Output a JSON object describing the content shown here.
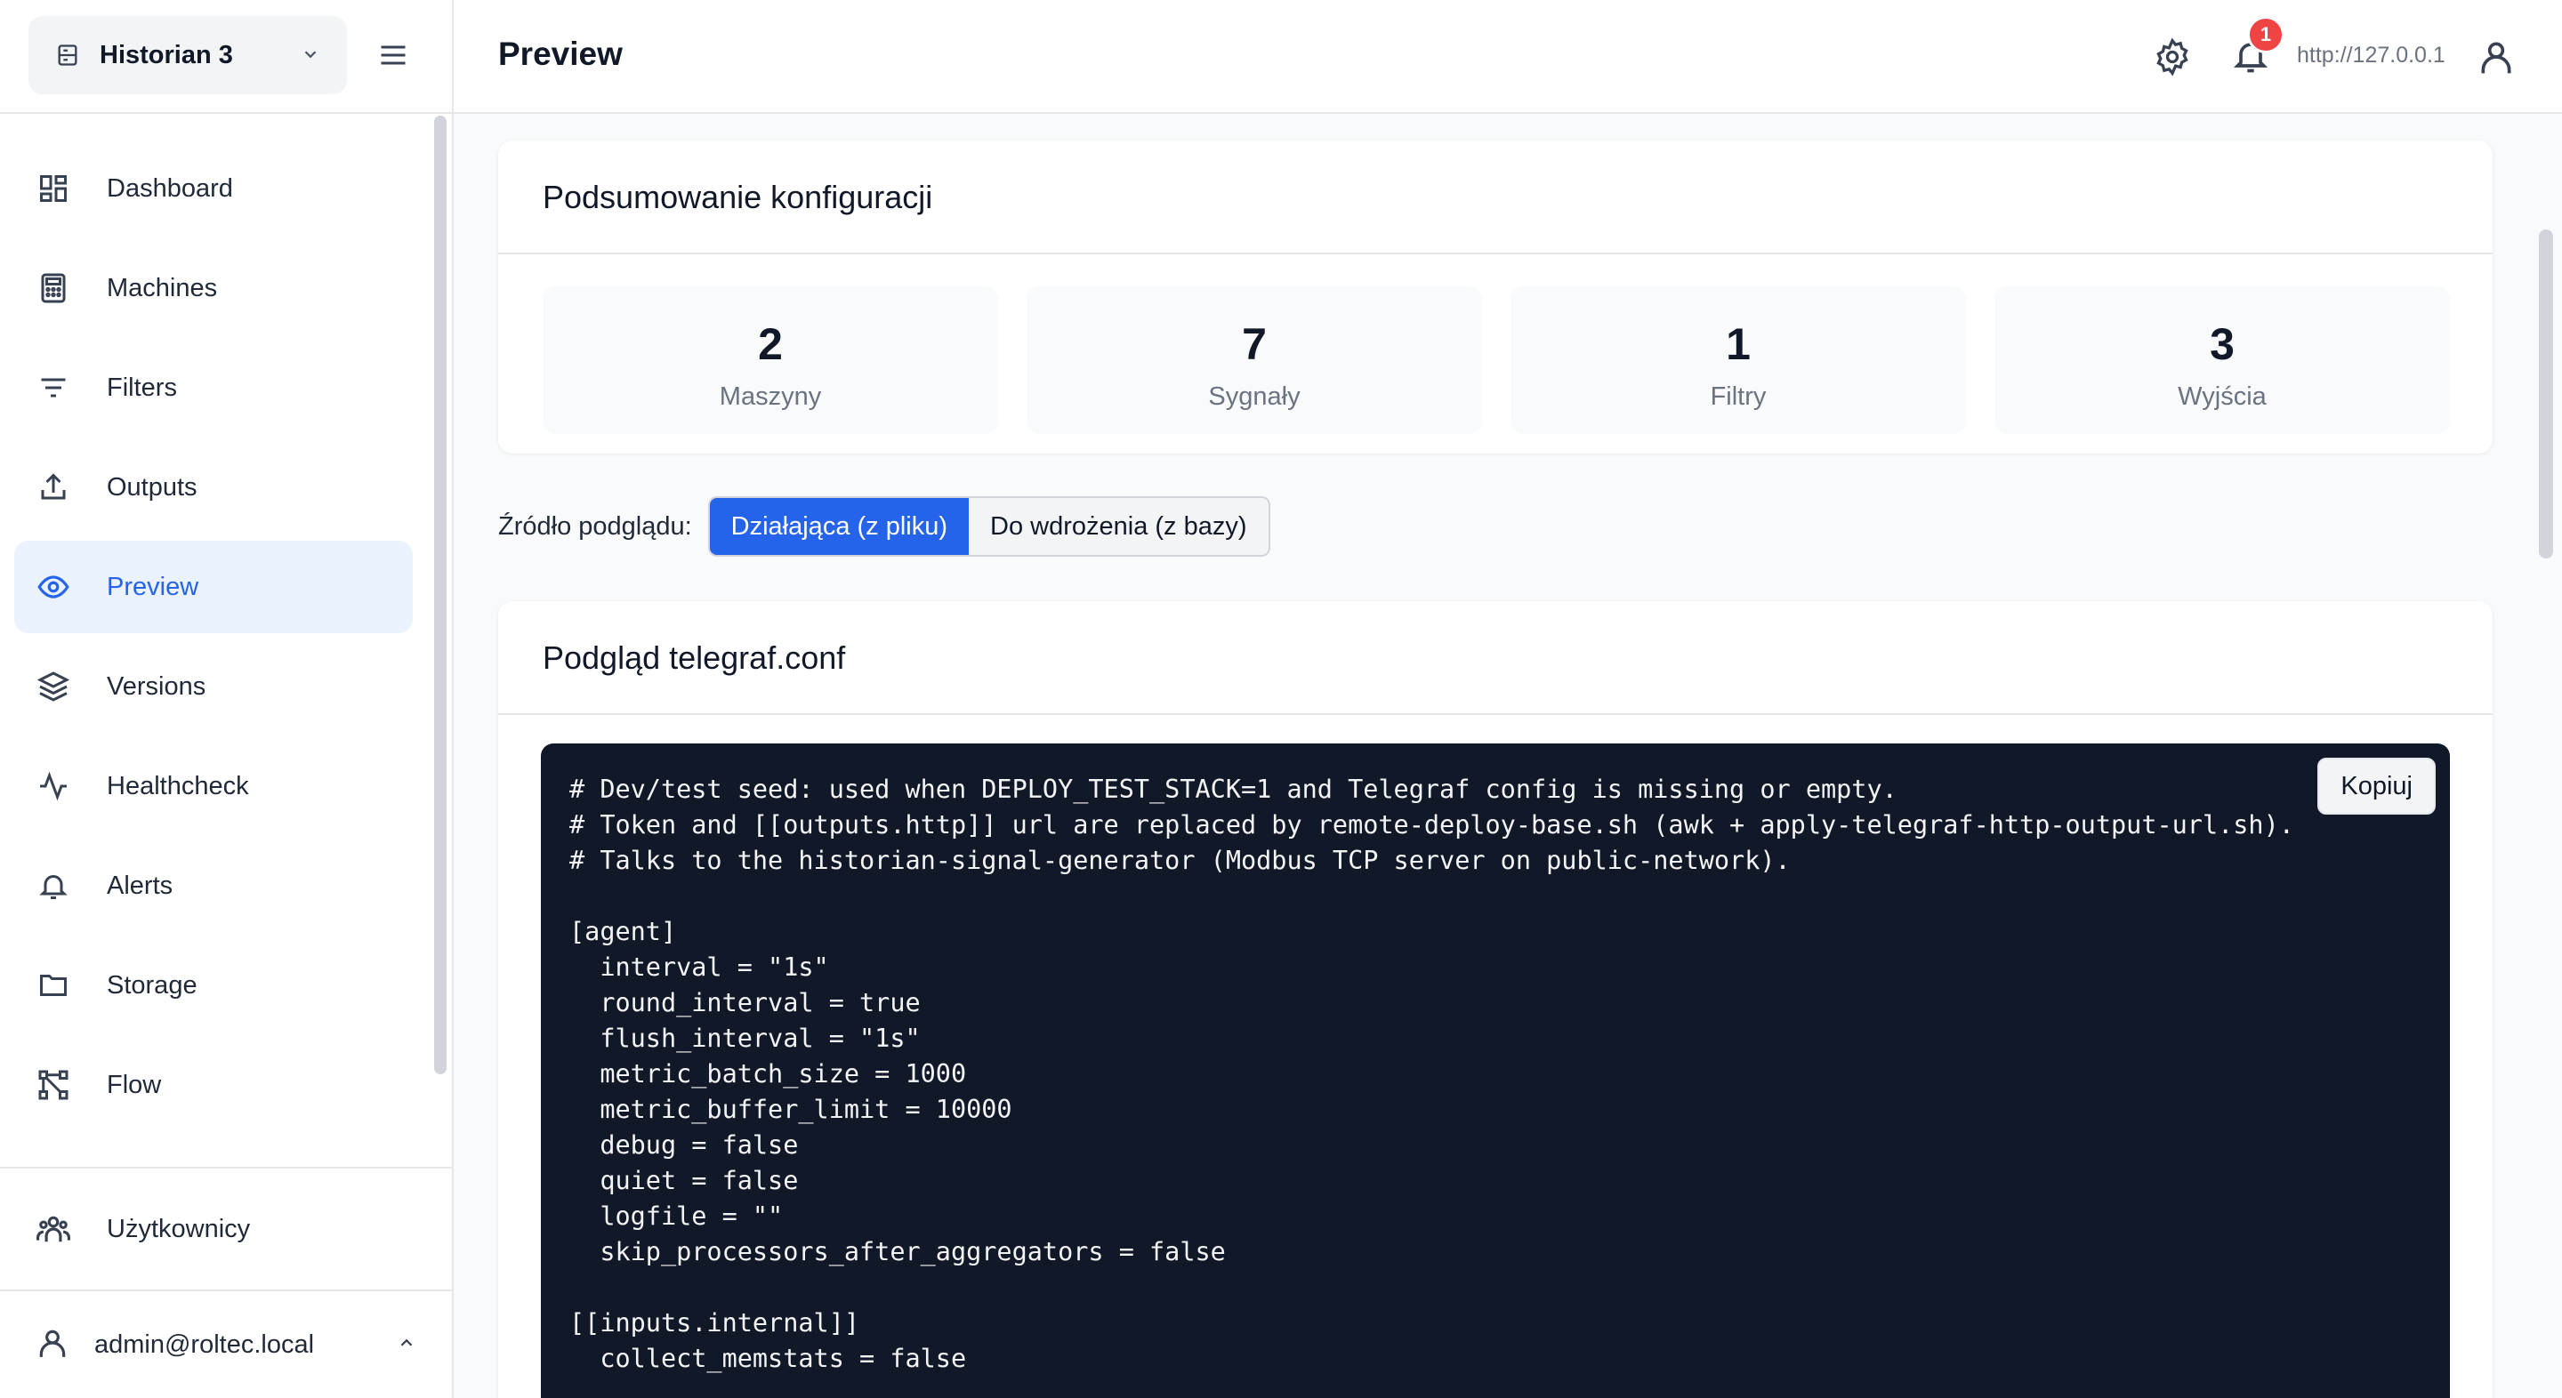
{
  "sidebar": {
    "instance": "Historian 3",
    "items": [
      {
        "label": "Dashboard",
        "icon": "dashboard-icon"
      },
      {
        "label": "Machines",
        "icon": "machines-icon"
      },
      {
        "label": "Filters",
        "icon": "filter-icon"
      },
      {
        "label": "Outputs",
        "icon": "upload-icon"
      },
      {
        "label": "Preview",
        "icon": "eye-icon",
        "active": true
      },
      {
        "label": "Versions",
        "icon": "layers-icon"
      },
      {
        "label": "Healthcheck",
        "icon": "pulse-icon"
      },
      {
        "label": "Alerts",
        "icon": "bell-icon"
      },
      {
        "label": "Storage",
        "icon": "folder-icon"
      },
      {
        "label": "Flow",
        "icon": "flow-icon"
      }
    ],
    "users_label": "Użytkownicy",
    "account": "admin@roltec.local"
  },
  "header": {
    "title": "Preview",
    "notifications_count": "1",
    "url": "http://127.0.0.1"
  },
  "summary": {
    "title": "Podsumowanie konfiguracji",
    "stats": [
      {
        "value": "2",
        "label": "Maszyny"
      },
      {
        "value": "7",
        "label": "Sygnały"
      },
      {
        "value": "1",
        "label": "Filtry"
      },
      {
        "value": "3",
        "label": "Wyjścia"
      }
    ]
  },
  "source": {
    "label": "Źródło podglądu:",
    "options": [
      "Działająca (z pliku)",
      "Do wdrożenia (z bazy)"
    ],
    "selected": "Działająca (z pliku)"
  },
  "preview": {
    "title": "Podgląd telegraf.conf",
    "copy_label": "Kopiuj",
    "code": "# Dev/test seed: used when DEPLOY_TEST_STACK=1 and Telegraf config is missing or empty.\n# Token and [[outputs.http]] url are replaced by remote-deploy-base.sh (awk + apply-telegraf-http-output-url.sh).\n# Talks to the historian-signal-generator (Modbus TCP server on public-network).\n\n[agent]\n  interval = \"1s\"\n  round_interval = true\n  flush_interval = \"1s\"\n  metric_batch_size = 1000\n  metric_buffer_limit = 10000\n  debug = false\n  quiet = false\n  logfile = \"\"\n  skip_processors_after_aggregators = false\n\n[[inputs.internal]]\n  collect_memstats = false"
  },
  "colors": {
    "accent": "#2563eb",
    "active_bg": "#eaf2fd",
    "badge": "#ef4444",
    "code_bg": "#111827"
  }
}
